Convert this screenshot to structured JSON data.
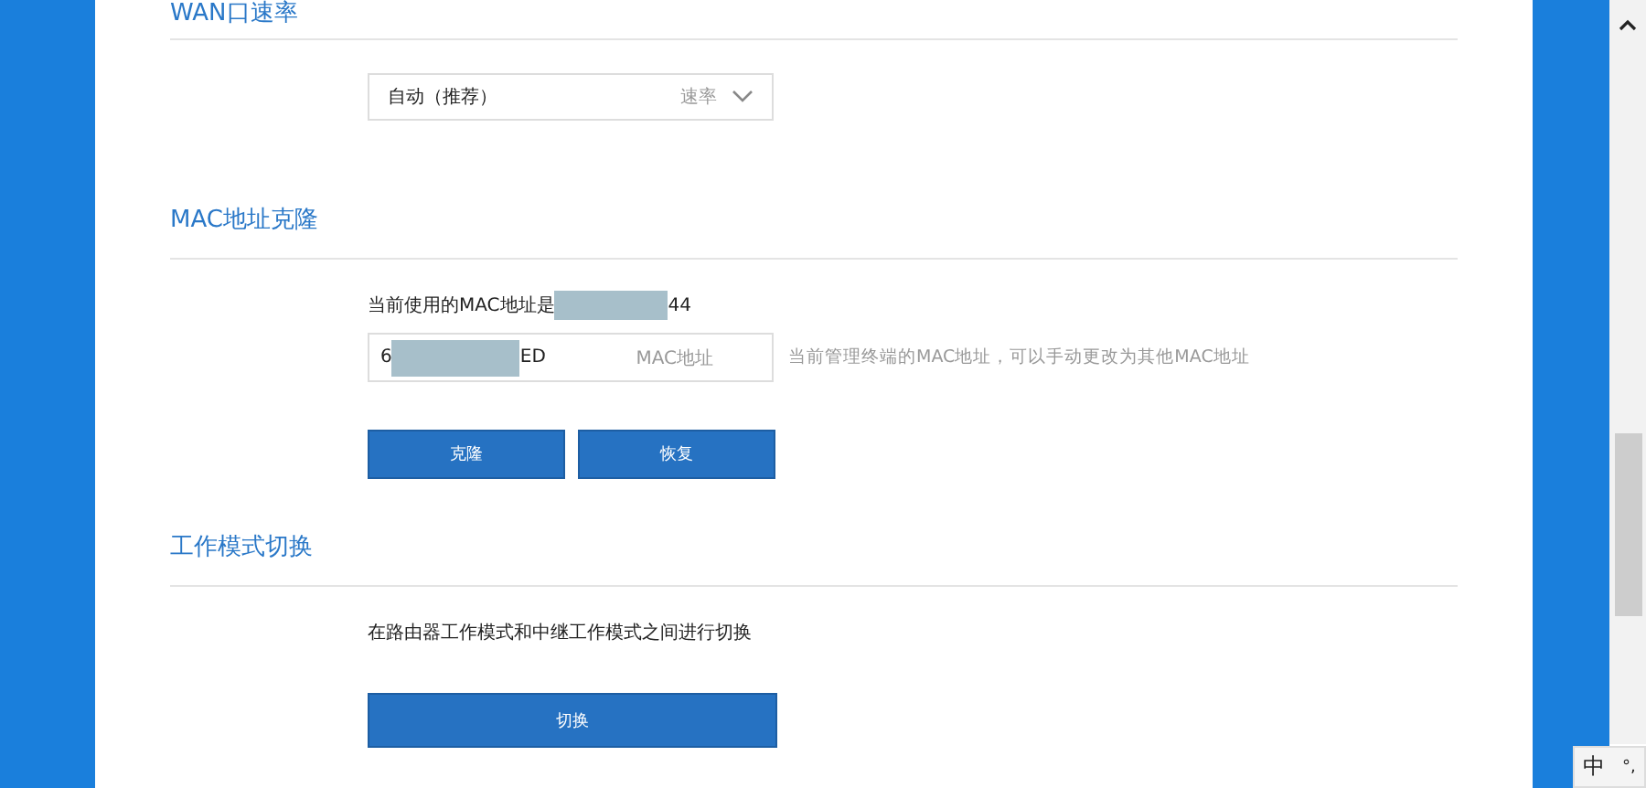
{
  "sections": [
    {
      "kind": "select",
      "title": "WAN口速率",
      "value": "自动（推荐）",
      "field_label": "速率"
    },
    {
      "kind": "mac",
      "title": "MAC地址克隆",
      "current_prefix": "当前使用的MAC地址是",
      "current_suffix": "44",
      "input_prefix": "6",
      "input_suffix": "ED",
      "field_label": "MAC地址",
      "hint": "当前管理终端的MAC地址，可以手动更改为其他MAC地址",
      "buttons": [
        "克隆",
        "恢复"
      ]
    },
    {
      "kind": "switch",
      "title": "工作模式切换",
      "description": "在路由器工作模式和中继工作模式之间进行切换",
      "buttons": [
        "切换"
      ]
    }
  ],
  "ime": {
    "mode": "中",
    "punct": "°,"
  }
}
